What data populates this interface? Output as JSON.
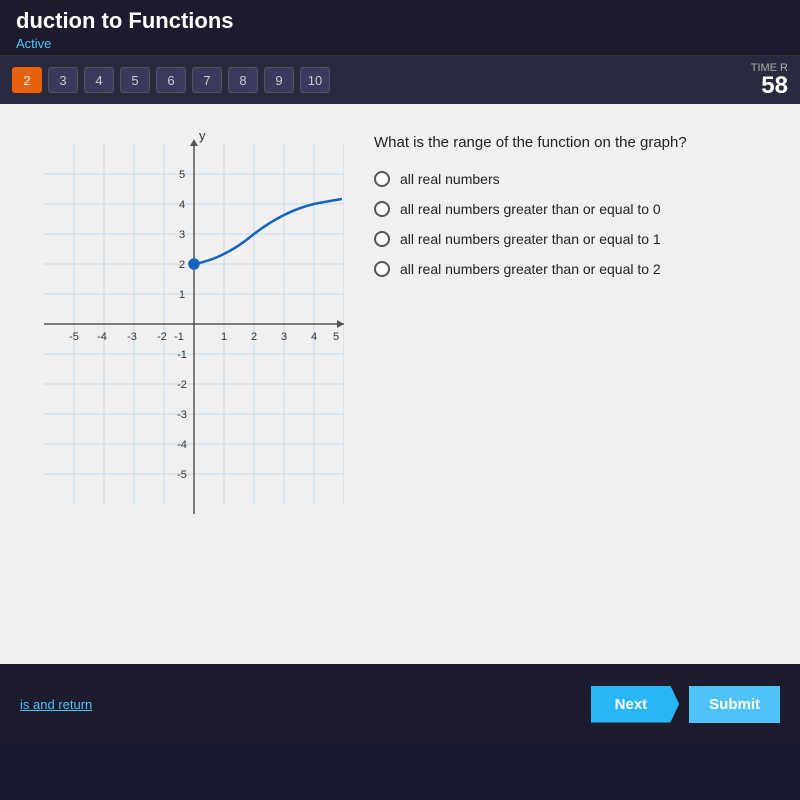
{
  "header": {
    "title": "duction to Functions",
    "subtitle": "Active"
  },
  "nav": {
    "buttons": [
      "2",
      "3",
      "4",
      "5",
      "6",
      "7",
      "8",
      "9",
      "10"
    ],
    "active_index": 0,
    "timer_label": "TIME R",
    "timer_value": "58"
  },
  "question": {
    "text": "What is the range of the function on the graph?",
    "options": [
      "all real numbers",
      "all real numbers greater than or equal to 0",
      "all real numbers greater than or equal to 1",
      "all real numbers greater than or equal to 2"
    ]
  },
  "bottom": {
    "skip_link": "is and return",
    "next_label": "Next",
    "submit_label": "Submit"
  }
}
